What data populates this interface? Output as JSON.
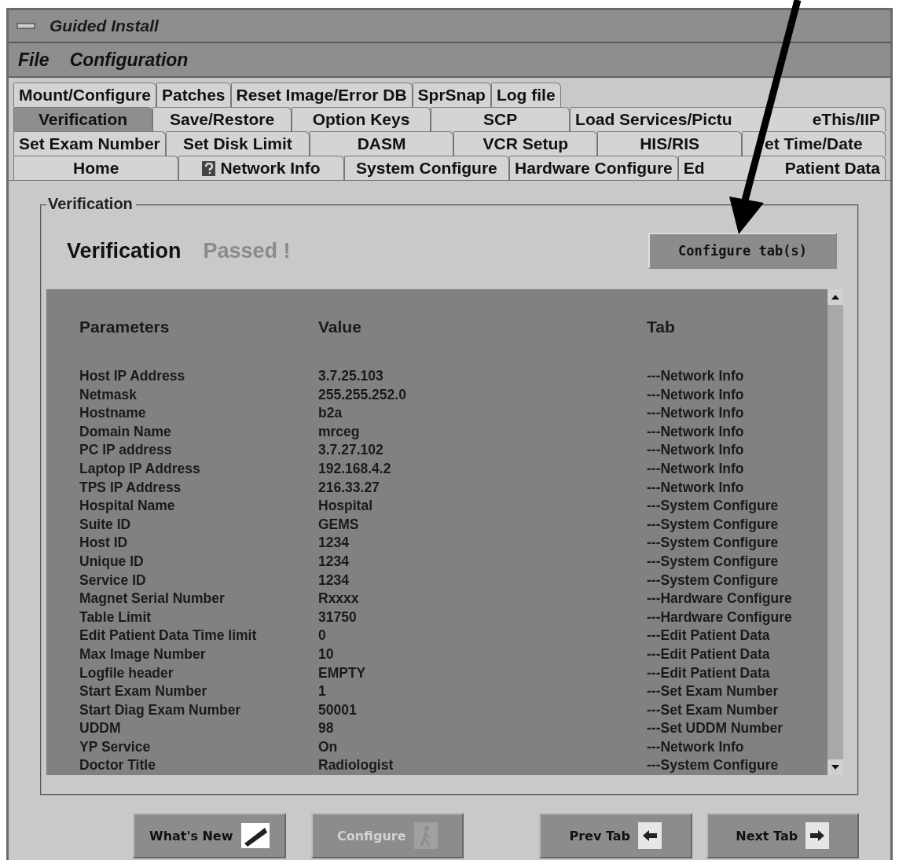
{
  "window": {
    "title": "Guided Install"
  },
  "menu": [
    "File",
    "Configuration"
  ],
  "tab_rows": [
    [
      {
        "label": "Mount/Configure",
        "selected": false,
        "kind": "plain"
      },
      {
        "label": "Patches",
        "selected": false,
        "kind": "plain"
      },
      {
        "label": "Reset Image/Error DB",
        "selected": false,
        "kind": "plain"
      },
      {
        "label": "SprSnap",
        "selected": false,
        "kind": "plain"
      },
      {
        "label": "Log file",
        "selected": false,
        "kind": "plain"
      }
    ],
    [
      {
        "label": "Verification",
        "selected": true,
        "kind": "plain"
      },
      {
        "label": "Save/Restore",
        "selected": false,
        "kind": "plain"
      },
      {
        "label": "Option Keys",
        "selected": false,
        "kind": "plain"
      },
      {
        "label": "SCP",
        "selected": false,
        "kind": "plain"
      },
      {
        "label_parts": [
          "Load Services/Pictu",
          "eThis/IIP"
        ],
        "selected": false,
        "kind": "plain"
      }
    ],
    [
      {
        "label": "Set Exam Number",
        "selected": false,
        "kind": "plain"
      },
      {
        "label": "Set Disk Limit",
        "selected": false,
        "kind": "plain"
      },
      {
        "label": "DASM",
        "selected": false,
        "kind": "plain"
      },
      {
        "label": "VCR Setup",
        "selected": false,
        "kind": "plain"
      },
      {
        "label": "HIS/RIS",
        "selected": false,
        "kind": "plain"
      },
      {
        "label": "et Time/Date",
        "selected": false,
        "kind": "plain"
      }
    ],
    [
      {
        "label": "Home",
        "selected": false,
        "kind": "plain"
      },
      {
        "label": "Network Info",
        "selected": false,
        "kind": "help"
      },
      {
        "label": "System Configure",
        "selected": false,
        "kind": "plain"
      },
      {
        "label": "Hardware Configure",
        "selected": false,
        "kind": "plain"
      },
      {
        "label_parts": [
          "Ed",
          "Patient Data"
        ],
        "selected": false,
        "kind": "plain"
      }
    ]
  ],
  "panel": {
    "legend": "Verification",
    "heading": "Verification",
    "status": "Passed !",
    "configure_button": "Configure tab(s)",
    "columns": [
      "Parameters",
      "Value",
      "Tab"
    ],
    "rows": [
      [
        "Host IP Address",
        "3.7.25.103",
        "---Network Info"
      ],
      [
        "Netmask",
        "255.255.252.0",
        "---Network Info"
      ],
      [
        "Hostname",
        "b2a",
        "---Network Info"
      ],
      [
        "Domain Name",
        "mrceg",
        "---Network Info"
      ],
      [
        "PC IP address",
        "3.7.27.102",
        "---Network Info"
      ],
      [
        "Laptop IP Address",
        "192.168.4.2",
        "---Network Info"
      ],
      [
        "TPS IP Address",
        "216.33.27",
        "---Network Info"
      ],
      [
        "Hospital Name",
        "Hospital",
        "---System Configure"
      ],
      [
        "Suite ID",
        "GEMS",
        "---System Configure"
      ],
      [
        "Host ID",
        "1234",
        "---System Configure"
      ],
      [
        "Unique ID",
        "1234",
        "---System Configure"
      ],
      [
        "Service ID",
        "1234",
        "---System Configure"
      ],
      [
        "Magnet Serial Number",
        "Rxxxx",
        "---Hardware Configure"
      ],
      [
        "Table Limit",
        "31750",
        "---Hardware Configure"
      ],
      [
        "Edit Patient Data Time limit",
        "0",
        "---Edit Patient Data"
      ],
      [
        "Max Image Number",
        "10",
        "---Edit Patient Data"
      ],
      [
        "Logfile header",
        "EMPTY",
        "---Edit Patient Data"
      ],
      [
        "Start Exam Number",
        "1",
        "---Set Exam Number"
      ],
      [
        "Start Diag Exam Number",
        "50001",
        "---Set Exam Number"
      ],
      [
        "UDDM",
        "98",
        "---Set UDDM Number"
      ],
      [
        "YP Service",
        "On",
        "---Network Info"
      ],
      [
        "Doctor Title",
        "Radiologist",
        "---System Configure"
      ]
    ]
  },
  "buttons": [
    {
      "label": "What's New",
      "kind": "new",
      "disabled": false
    },
    {
      "label": "Configure",
      "kind": "figure",
      "disabled": true
    },
    {
      "label": "Prev Tab",
      "kind": "prev",
      "disabled": false
    },
    {
      "label": "Next Tab",
      "kind": "next",
      "disabled": false
    }
  ]
}
